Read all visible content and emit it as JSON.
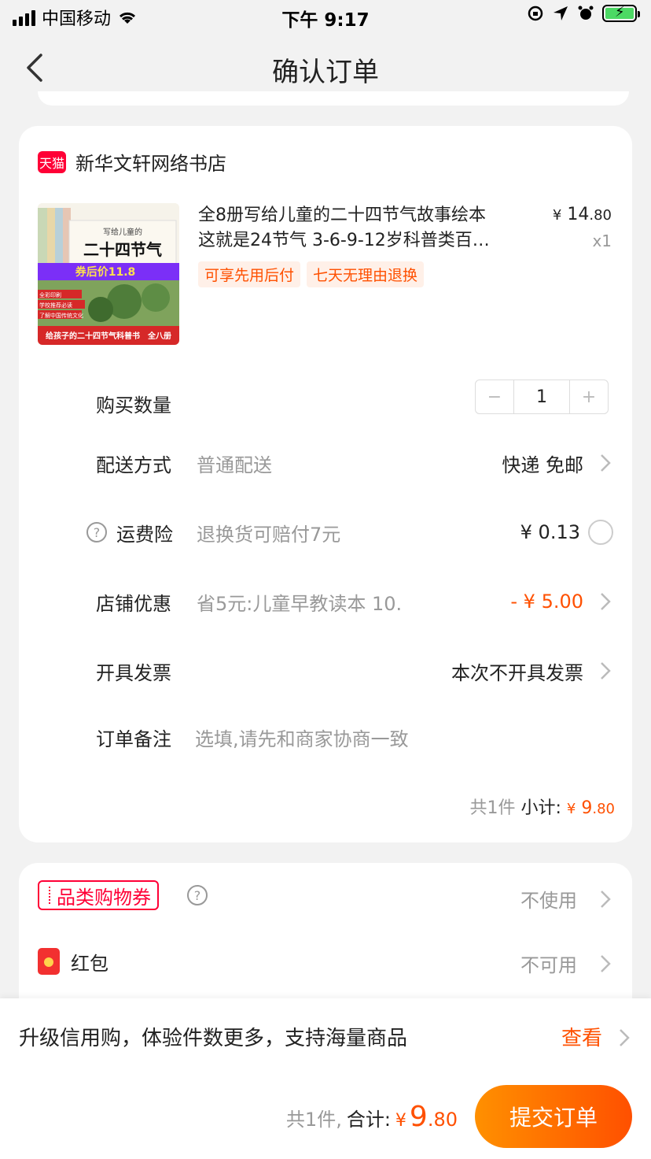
{
  "status_bar": {
    "carrier": "中国移动",
    "time": "下午 9:17"
  },
  "nav": {
    "title": "确认订单"
  },
  "shop": {
    "badge": "天猫",
    "name": "新华文轩网络书店"
  },
  "product": {
    "title_line1": "全8册写给儿童的二十四节气故事绘本",
    "title_line2": "这就是24节气 3-6-9-12岁科普类百…",
    "price_currency": "¥",
    "price_int": "14",
    "price_dec": ".80",
    "quantity_label": "x1",
    "tags": [
      "可享先用后付",
      "七天无理由退换"
    ],
    "thumb": {
      "banner": "券后价11.8",
      "book_title": "二十四节气",
      "book_header": "写给儿童的",
      "bottom": "给孩子的二十四节气科普书　全八册",
      "badges": [
        "全彩印刷",
        "学校推荐必读",
        "了解中国传统文化"
      ]
    }
  },
  "rows": {
    "quantity": {
      "label": "购买数量",
      "value": "1",
      "minus": "−",
      "plus": "+"
    },
    "delivery": {
      "label": "配送方式",
      "desc": "普通配送",
      "value": "快递 免邮"
    },
    "insurance": {
      "label": "运费险",
      "desc": "退换货可赔付7元",
      "value": "¥ 0.13",
      "help": "?"
    },
    "discount": {
      "label": "店铺优惠",
      "desc": "省5元:儿童早教读本 10.",
      "value": "- ¥ 5.00"
    },
    "invoice": {
      "label": "开具发票",
      "value": "本次不开具发票"
    },
    "note": {
      "label": "订单备注",
      "placeholder": "选填,请先和商家协商一致"
    }
  },
  "subtotal": {
    "count": "共1件",
    "label": "小计:",
    "currency": "¥",
    "int": "9",
    "dec": ".80"
  },
  "coupon": {
    "label": "品类购物券",
    "help": "?",
    "value": "不使用"
  },
  "hongbao": {
    "label": "红包",
    "value": "不可用"
  },
  "promo": {
    "text": "升级信用购，体验件数更多，支持海量商品",
    "link": "查看"
  },
  "footer": {
    "count": "共1件,",
    "label": "合计:",
    "currency": "¥",
    "int": "9",
    "dec": ".80",
    "submit": "提交订单"
  },
  "colors": {
    "accent": "#ff5000",
    "tmall_red": "#ff0036",
    "background": "#f2f2f2"
  }
}
